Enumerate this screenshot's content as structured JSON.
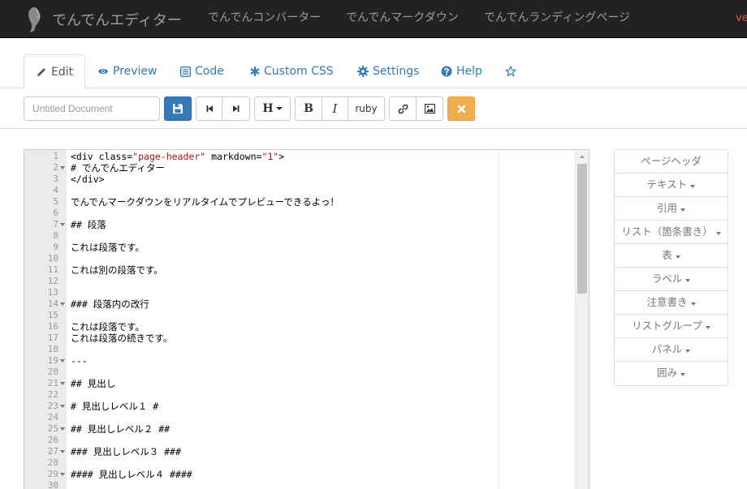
{
  "navbar": {
    "brand": "でんでんエディター",
    "links": [
      "でんでんコンバーター",
      "でんでんマークダウン",
      "でんでんランディングページ"
    ],
    "extra": "ve"
  },
  "tabs": [
    {
      "label": "Edit",
      "icon": "pencil-icon",
      "active": true
    },
    {
      "label": "Preview",
      "icon": "eye-icon"
    },
    {
      "label": "Code",
      "icon": "list-alt-icon"
    },
    {
      "label": "Custom CSS",
      "icon": "asterisk-icon"
    },
    {
      "label": "Settings",
      "icon": "gear-icon"
    },
    {
      "label": "Help",
      "icon": "question-icon"
    },
    {
      "label": "",
      "icon": "star-icon"
    }
  ],
  "toolbar": {
    "title_placeholder": "Untitled Document",
    "heading_label": "H",
    "bold_label": "B",
    "italic_label": "I",
    "ruby_label": "ruby"
  },
  "editor": {
    "lines": [
      {
        "n": "1",
        "text": "<div class=\"page-header\" markdown=\"1\">"
      },
      {
        "n": "2",
        "text": "# でんでんエディター",
        "fold": true
      },
      {
        "n": "3",
        "text": "</div>"
      },
      {
        "n": "4",
        "text": ""
      },
      {
        "n": "5",
        "text": "でんでんマークダウンをリアルタイムでプレビューできるよっ！"
      },
      {
        "n": "6",
        "text": ""
      },
      {
        "n": "7",
        "text": "## 段落",
        "fold": true
      },
      {
        "n": "8",
        "text": ""
      },
      {
        "n": "9",
        "text": "これは段落です。"
      },
      {
        "n": "10",
        "text": ""
      },
      {
        "n": "11",
        "text": "これは別の段落です。"
      },
      {
        "n": "12",
        "text": ""
      },
      {
        "n": "13",
        "text": ""
      },
      {
        "n": "14",
        "text": "### 段落内の改行",
        "fold": true
      },
      {
        "n": "15",
        "text": ""
      },
      {
        "n": "16",
        "text": "これは段落です。"
      },
      {
        "n": "17",
        "text": "これは段落の続きです。"
      },
      {
        "n": "18",
        "text": ""
      },
      {
        "n": "19",
        "text": "---",
        "fold": true
      },
      {
        "n": "20",
        "text": ""
      },
      {
        "n": "21",
        "text": "## 見出し",
        "fold": true
      },
      {
        "n": "22",
        "text": ""
      },
      {
        "n": "23",
        "text": "# 見出しレベル１ #",
        "fold": true
      },
      {
        "n": "24",
        "text": ""
      },
      {
        "n": "25",
        "text": "## 見出しレベル２ ##",
        "fold": true
      },
      {
        "n": "26",
        "text": ""
      },
      {
        "n": "27",
        "text": "### 見出しレベル３ ###",
        "fold": true
      },
      {
        "n": "28",
        "text": ""
      },
      {
        "n": "29",
        "text": "#### 見出しレベル４ ####",
        "fold": true
      },
      {
        "n": "30",
        "text": ""
      }
    ]
  },
  "sidebar": {
    "items": [
      {
        "label": "ページヘッダ",
        "dropdown": false
      },
      {
        "label": "テキスト",
        "dropdown": true
      },
      {
        "label": "引用",
        "dropdown": true
      },
      {
        "label": "リスト（箇条書き）",
        "dropdown": true
      },
      {
        "label": "表",
        "dropdown": true
      },
      {
        "label": "ラベル",
        "dropdown": true
      },
      {
        "label": "注意書き",
        "dropdown": true
      },
      {
        "label": "リストグループ",
        "dropdown": true
      },
      {
        "label": "パネル",
        "dropdown": true
      },
      {
        "label": "囲み",
        "dropdown": true
      }
    ]
  },
  "colors": {
    "navbar_bg": "#222222",
    "link_blue": "#337ab7",
    "primary": "#337ab7",
    "warning": "#f0ad4e",
    "attr_string": "#a31515"
  }
}
